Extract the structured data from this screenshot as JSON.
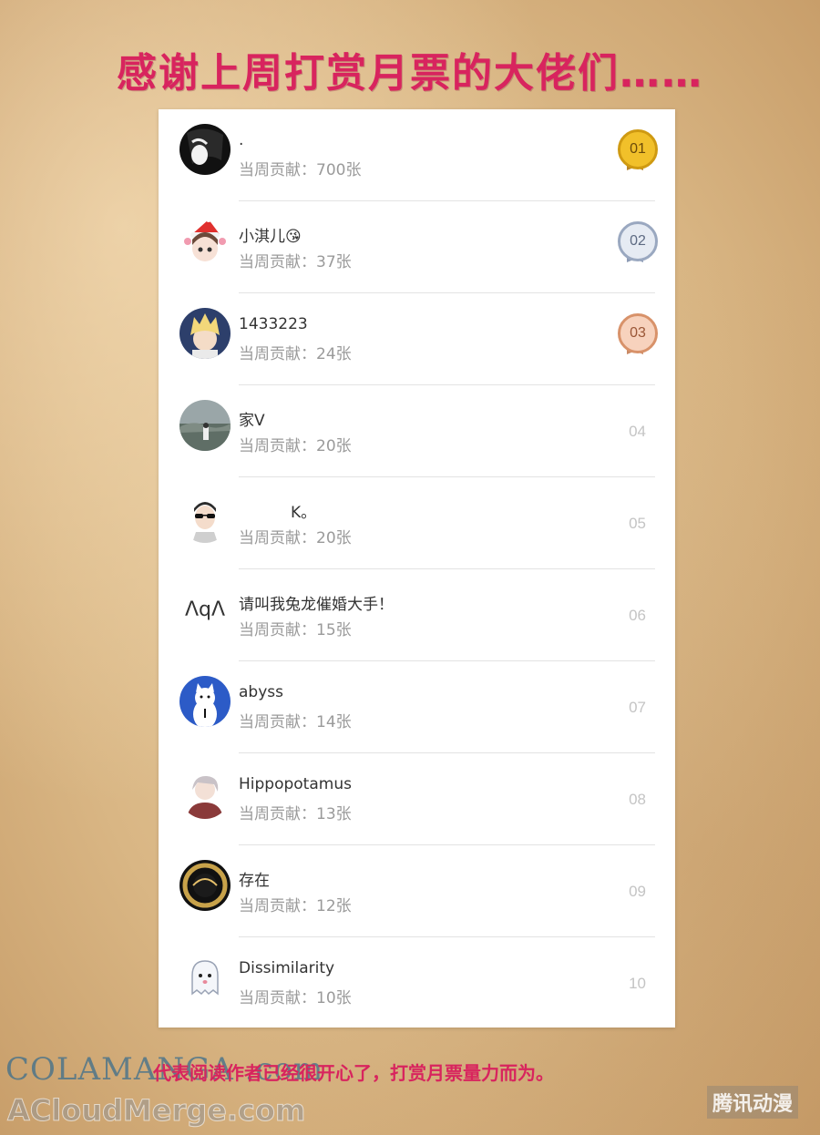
{
  "title": "感谢上周打赏月票的大佬们……",
  "footer": "代表阅读作者已经很开心了，打赏月票量力而为。",
  "watermarks": {
    "colamanga": "COLAMANGA .com",
    "acloudmerge": "ACloudMerge.com",
    "tencent": "腾讯动漫"
  },
  "colors": {
    "title": "#d8245e",
    "gold": "#e9b41c",
    "silver": "#a9b6cc",
    "bronze": "#e3a07a"
  },
  "rows": [
    {
      "name": ".",
      "contribution": "当周贡献：700张",
      "rank": "01",
      "medal": "gold",
      "avatar": "dark-anime-avatar"
    },
    {
      "name": "小淇儿😘",
      "contribution": "当周贡献：37张",
      "rank": "02",
      "medal": "silver",
      "avatar": "christmas-girl-avatar"
    },
    {
      "name": "1433223",
      "contribution": "当周贡献：24张",
      "rank": "03",
      "medal": "bronze",
      "avatar": "blonde-anime-avatar"
    },
    {
      "name": "家V",
      "contribution": "当周贡献：20张",
      "rank": "04",
      "medal": "",
      "avatar": "landscape-photo-avatar"
    },
    {
      "name": "K。",
      "contribution": "当周贡献：20张",
      "rank": "05",
      "medal": "",
      "avatar": "sunglasses-man-avatar"
    },
    {
      "name": "请叫我兔龙催婚大手！",
      "contribution": "当周贡献：15张",
      "rank": "06",
      "medal": "",
      "avatar": "text-avatar",
      "avatar_text": "ΛqΛ"
    },
    {
      "name": "abyss",
      "contribution": "当周贡献：14张",
      "rank": "07",
      "medal": "",
      "avatar": "cat-avatar"
    },
    {
      "name": "Hippopotamus",
      "contribution": "当周贡献：13张",
      "rank": "08",
      "medal": "",
      "avatar": "grey-hair-avatar"
    },
    {
      "name": "存在",
      "contribution": "当周贡献：12张",
      "rank": "09",
      "medal": "",
      "avatar": "eclipse-avatar"
    },
    {
      "name": "Dissimilarity",
      "contribution": "当周贡献：10张",
      "rank": "10",
      "medal": "",
      "avatar": "ghost-avatar"
    }
  ]
}
